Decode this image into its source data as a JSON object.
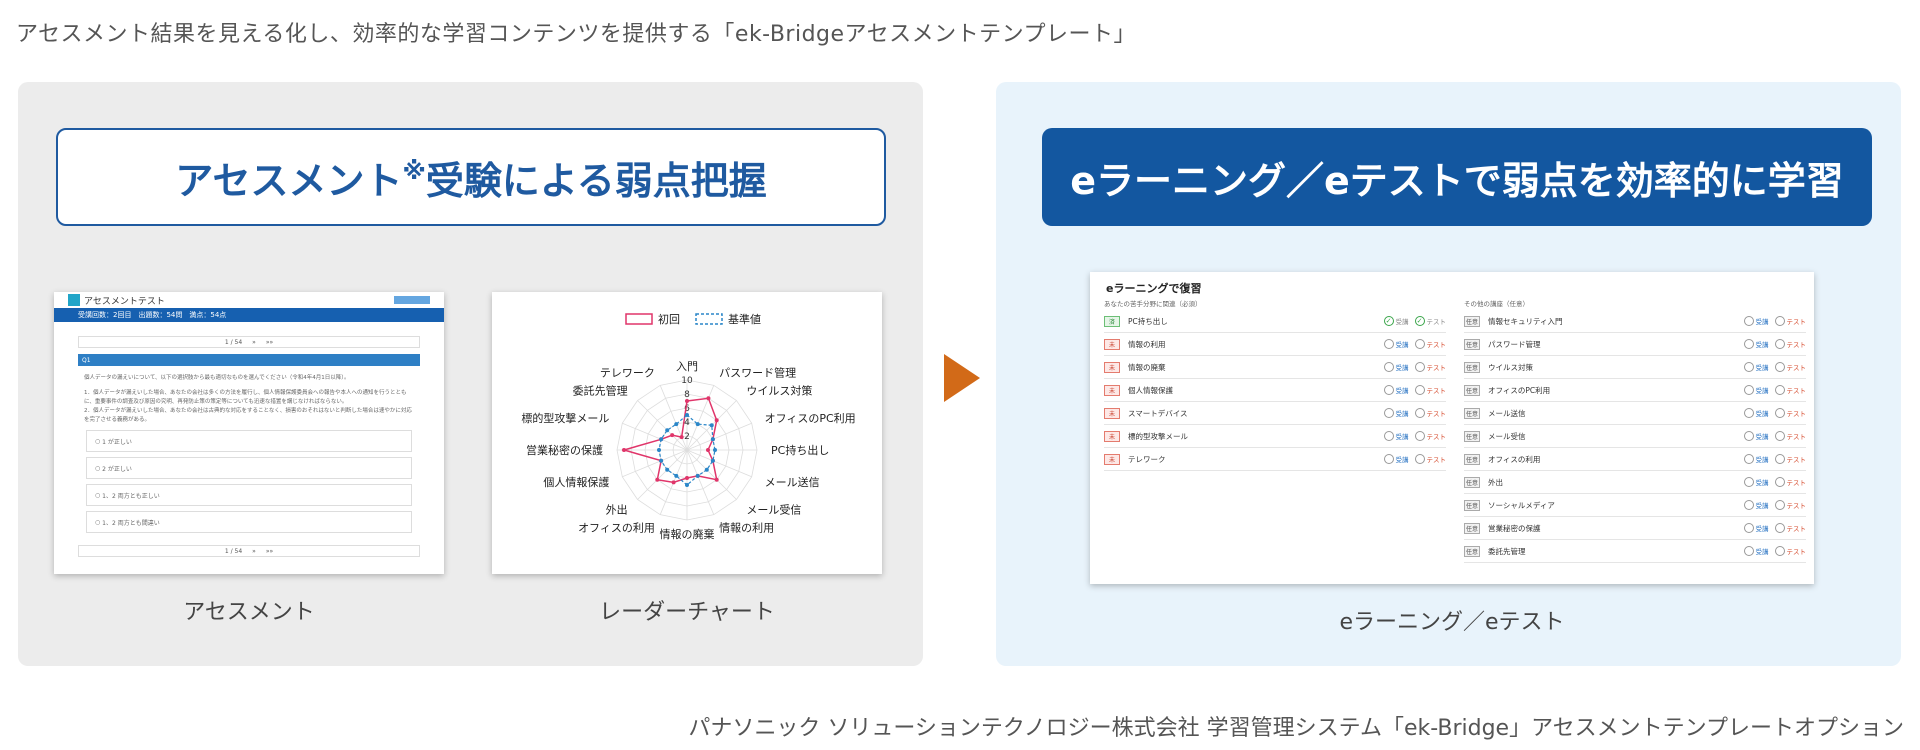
{
  "page_title": "アセスメント結果を見える化し、効率的な学習コンテンツを提供する「ek-Bridgeアセスメントテンプレート」",
  "footer": "パナソニック ソリューションテクノロジー株式会社 学習管理システム「ek-Bridge」アセスメントテンプレートオプション",
  "left_panel": {
    "banner_pre": "アセスメント",
    "banner_mark": "※",
    "banner_post": "受験による弱点把握",
    "assessment": {
      "title": "アセスメントテスト",
      "info": "受講回数：2回目　出題数：54問　満点：54点",
      "pager": [
        "1 / 54",
        "»",
        "»»"
      ],
      "q_label": "Q1",
      "q_text": "個人データの漏えいについて、以下の選択肢から最も適切なものを選んでください（令和4年4月1日以降）。",
      "q_detail1": "1．個人データが漏えいした場合、あなたの会社は多くの方法を履行し、個人情報保護委員会への報告や本人への通知を行うとともに、重要事件の調査及び原因の究明、再発防止策の策定等についても迅速な措置を講じなければならない。",
      "q_detail2": "2．個人データが漏えいした場合、あなたの会社は古典的な対応をすることなく、損害のおそれはないと判断した場合は速やかに対応を完了させる義務がある。",
      "options": [
        "1 が正しい",
        "2 が正しい",
        "1、2 両方とも正しい",
        "1、2 両方とも間違い"
      ],
      "caption": "アセスメント"
    },
    "radar": {
      "caption": "レーダーチャート"
    }
  },
  "right_panel": {
    "banner": "eラーニング／eテストで弱点を効率的に学習",
    "elearning": {
      "title": "eラーニングで復習",
      "left_col_title": "あなたの苦手分野に関連（必須）",
      "right_col_title": "その他の講座（任意）",
      "watch_label": "受講",
      "test_label": "テスト",
      "left_items": [
        {
          "status": "済",
          "type": "done",
          "name": "PC持ち出し"
        },
        {
          "status": "未",
          "type": "todo",
          "name": "情報の利用"
        },
        {
          "status": "未",
          "type": "todo",
          "name": "情報の廃棄"
        },
        {
          "status": "未",
          "type": "todo",
          "name": "個人情報保護"
        },
        {
          "status": "未",
          "type": "todo",
          "name": "スマートデバイス"
        },
        {
          "status": "未",
          "type": "todo",
          "name": "標的型攻撃メール"
        },
        {
          "status": "未",
          "type": "todo",
          "name": "テレワーク"
        }
      ],
      "right_items": [
        {
          "status": "任意",
          "name": "情報セキュリティ入門"
        },
        {
          "status": "任意",
          "name": "パスワード管理"
        },
        {
          "status": "任意",
          "name": "ウイルス対策"
        },
        {
          "status": "任意",
          "name": "オフィスのPC利用"
        },
        {
          "status": "任意",
          "name": "メール送信"
        },
        {
          "status": "任意",
          "name": "メール受信"
        },
        {
          "status": "任意",
          "name": "オフィスの利用"
        },
        {
          "status": "任意",
          "name": "外出"
        },
        {
          "status": "任意",
          "name": "ソーシャルメディア"
        },
        {
          "status": "任意",
          "name": "営業秘密の保護"
        },
        {
          "status": "任意",
          "name": "委託先管理"
        }
      ],
      "caption": "eラーニング／eテスト"
    }
  },
  "chart_data": {
    "type": "radar",
    "legend": [
      "初回",
      "基準値"
    ],
    "legend_placement": "top",
    "categories": [
      "入門",
      "パスワード管理",
      "ウイルス対策",
      "オフィスのPC利用",
      "PC持ち出し",
      "メール送信",
      "メール受信",
      "情報の利用",
      "情報の廃棄",
      "オフィスの利用",
      "外出",
      "個人情報保護",
      "営業秘密の保護",
      "標的型攻撃メール",
      "委託先管理",
      "テレワーク"
    ],
    "range": [
      0,
      10
    ],
    "ticks": [
      "2",
      "4",
      "6",
      "8",
      "10"
    ],
    "series": [
      {
        "name": "初回",
        "color": "#e0356a",
        "values": [
          7,
          8,
          6,
          4,
          3,
          4,
          6,
          4,
          4,
          5,
          6,
          4,
          9,
          4,
          3,
          2
        ]
      },
      {
        "name": "基準値",
        "color": "#2a86c8",
        "values": [
          5,
          4,
          5,
          4,
          4,
          4,
          4,
          4,
          5,
          4,
          4,
          4,
          4,
          4,
          4,
          4
        ]
      }
    ]
  }
}
